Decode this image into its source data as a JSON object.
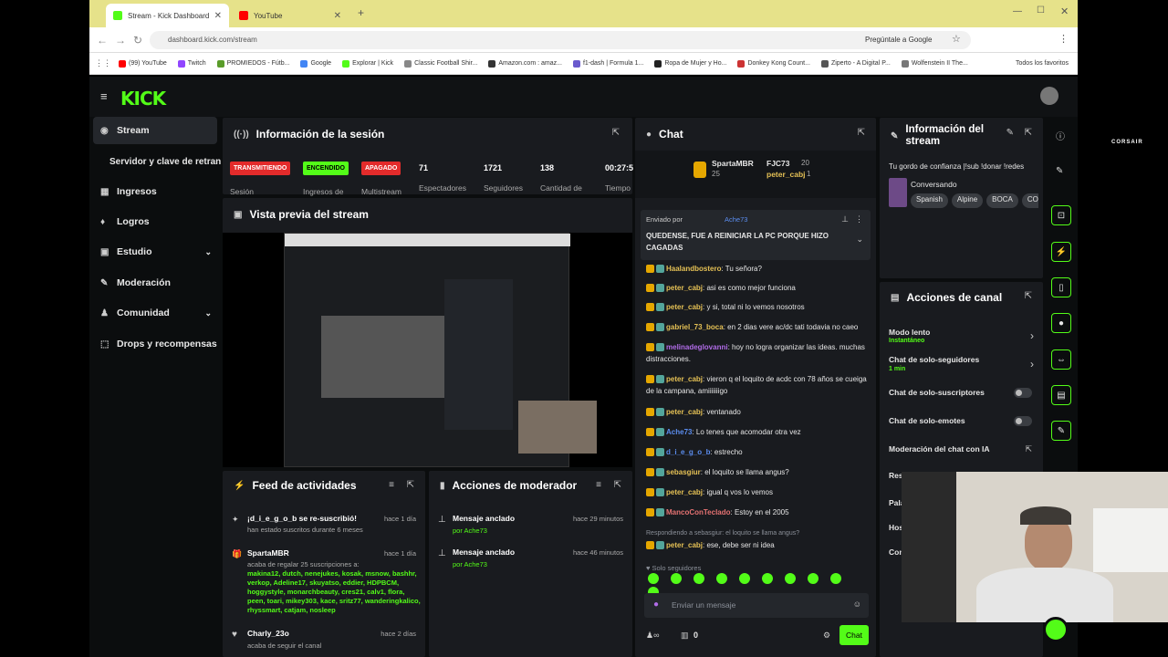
{
  "browser": {
    "tabs": [
      {
        "label": "Stream - Kick Dashboard",
        "fav": "#53fc18"
      },
      {
        "label": "YouTube",
        "fav": "#f00"
      }
    ],
    "url": "dashboard.kick.com/stream",
    "ask_google": "Pregúntale a Google",
    "bookmarks": [
      "(99) YouTube",
      "Twitch",
      "PROMIEDOS - Fútb...",
      "Google",
      "Explorar | Kick",
      "Classic Football Shir...",
      "Amazon.com : amaz...",
      "f1-dash | Formula 1...",
      "Ropa de Mujer y Ho...",
      "Donkey Kong Count...",
      "Ziperto - A Digital P...",
      "Wolfenstein II The..."
    ],
    "all_bookmarks": "Todos los favoritos"
  },
  "app": {
    "logo": "KICK",
    "sidebar": [
      {
        "label": "Stream",
        "icon": "stream-icon"
      },
      {
        "label": "Servidor y clave de retransn",
        "icon": ""
      },
      {
        "label": "Ingresos",
        "icon": "revenue-icon"
      },
      {
        "label": "Logros",
        "icon": "trophy-icon"
      },
      {
        "label": "Estudio",
        "icon": "studio-icon"
      },
      {
        "label": "Moderación",
        "icon": "wrench-icon"
      },
      {
        "label": "Comunidad",
        "icon": "community-icon"
      },
      {
        "label": "Drops y recompensas",
        "icon": "drops-icon"
      }
    ],
    "session": {
      "title": "Información de la sesión",
      "badges": [
        {
          "text": "TRANSMITIENDO",
          "bg": "#e32b2b",
          "fg": "#fff"
        },
        {
          "text": "ENCENDIDO",
          "bg": "#53fc18",
          "fg": "#000"
        },
        {
          "text": "APAGADO",
          "bg": "#e32b2b",
          "fg": "#fff"
        }
      ],
      "badge_labels": [
        "Sesión",
        "Ingresos de",
        "Multistream"
      ],
      "stats": [
        {
          "num": "71",
          "label": "Espectadores"
        },
        {
          "num": "1721",
          "label": "Seguidores"
        },
        {
          "num": "138",
          "label": "Cantidad de"
        },
        {
          "num": "00:27:5",
          "label": "Tiempo"
        }
      ]
    },
    "preview": {
      "title": "Vista previa del stream"
    },
    "feed": {
      "title": "Feed de actividades",
      "items": [
        {
          "name": "¡d_i_e_g_o_b se re-suscribió!",
          "sub": "han estado suscritos durante 6 meses",
          "time": "hace 1 día"
        },
        {
          "name": "SpartaMBR",
          "sub": "acaba de regalar 25 suscripciones a:",
          "users": "makina12, dutch, nenejukes, kosak, msnow, bashhr, verkop, Adeline17, skuyatso, eddier, HDPBCM, hoggystyle, monarchbeauty, cres21, calv1, flora, peen, toari, mikey303, kace, sritz77, wanderingkalico, rhyssmart, catjam, nosleep",
          "time": "hace 1 día"
        },
        {
          "name": "Charly_23o",
          "sub": "acaba de seguir el canal",
          "time": "hace 2 días"
        }
      ]
    },
    "modactions": {
      "title": "Acciones de moderador",
      "items": [
        {
          "name": "Mensaje anclado",
          "by": "por Ache73",
          "time": "hace 29 minutos"
        },
        {
          "name": "Mensaje anclado",
          "by": "por Ache73",
          "time": "hace 46 minutos"
        }
      ]
    },
    "chat": {
      "title": "Chat",
      "top": [
        {
          "name": "SpartaMBR",
          "count": "25"
        },
        {
          "name": "FJC73",
          "count": "20"
        },
        {
          "name": "peter_cabj",
          "count": "1"
        }
      ],
      "pinned_by": "Enviado por",
      "pinned_user": "Ache73",
      "pinned_text": "QUEDENSE, FUE A REINICIAR LA PC PORQUE HIZO CAGADAS",
      "messages": [
        {
          "user": "Haalandbostero",
          "color": "#e5c155",
          "text": "Tu señora?"
        },
        {
          "user": "peter_cabj",
          "color": "#e5c155",
          "text": "asi es como mejor funciona"
        },
        {
          "user": "peter_cabj",
          "color": "#e5c155",
          "text": "y si, total ni lo vemos nosotros"
        },
        {
          "user": "gabriel_73_boca",
          "color": "#e5c155",
          "text": "en 2 dias vere ac/dc tati todavia no caeo"
        },
        {
          "user": "melinadeglovanni",
          "color": "#b16ce8",
          "text": "hoy no logra organizar las ideas. muchas distracciones."
        },
        {
          "user": "peter_cabj",
          "color": "#e5c155",
          "text": "vieron q el loquito de acdc con 78 años se cueiga de la campana, amiiiiiiigo"
        },
        {
          "user": "peter_cabj",
          "color": "#e5c155",
          "text": "ventanado"
        },
        {
          "user": "Ache73",
          "color": "#5b8def",
          "text": "Lo tenes que acomodar otra vez"
        },
        {
          "user": "d_i_e_g_o_b",
          "color": "#5b8def",
          "text": "estrecho"
        },
        {
          "user": "sebasgiur",
          "color": "#e5c155",
          "text": "el loquito se llama angus?"
        },
        {
          "user": "peter_cabj",
          "color": "#e5c155",
          "text": "igual q vos lo vemos"
        },
        {
          "user": "MancoConTeclado",
          "color": "#e57272",
          "text": "Estoy en el 2005"
        },
        {
          "user": "peter_cabj",
          "color": "#e5c155",
          "text": "ese, debe ser ni idea"
        }
      ],
      "reply_to": "Respondiendo a sebasgiur: el loquito se llama angus?",
      "followers_only": "Solo seguidores",
      "input_placeholder": "Enviar un mensaje",
      "count": "0",
      "send": "Chat"
    },
    "streaminfo": {
      "title": "Información del stream",
      "stream_title": "Tu gordo de confianza |!sub !donar !redes",
      "category": "Conversando",
      "tags": [
        "Spanish",
        "Alpine",
        "BOCA",
        "COL"
      ]
    },
    "channel_actions": {
      "title": "Acciones de canal",
      "items": [
        {
          "label": "Modo lento",
          "sub": "Instantáneo"
        },
        {
          "label": "Chat de solo-seguidores",
          "sub": "1 min"
        },
        {
          "label": "Chat de solo-suscriptores",
          "sub": ""
        },
        {
          "label": "Chat de solo-emotes",
          "sub": ""
        },
        {
          "label": "Moderación del chat con IA",
          "sub": ""
        }
      ],
      "partial": [
        "Res",
        "Pala",
        "Hos",
        "Con"
      ]
    },
    "corsair": "CORSAIR"
  }
}
